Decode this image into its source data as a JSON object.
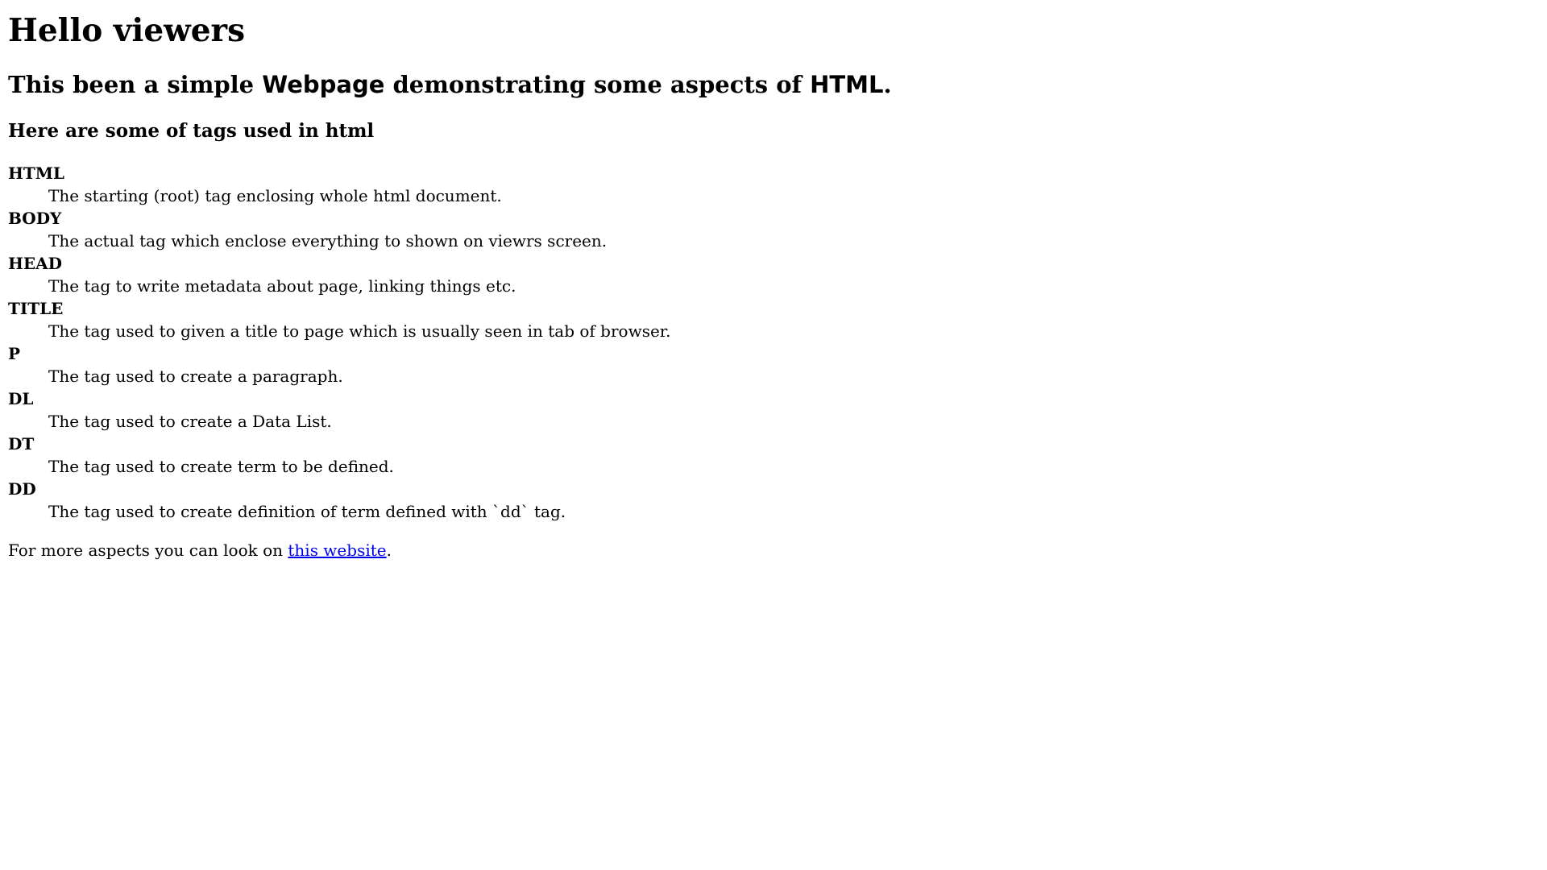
{
  "heading": "Hello viewers",
  "subheading": {
    "part1": "This been a simple ",
    "webpage": "Webpage",
    "part2": " demonstrating some aspects of ",
    "html": "HTML",
    "part3": "."
  },
  "tags_heading": "Here are some of tags used in html",
  "tags": [
    {
      "term": "HTML",
      "definition": "The starting (root) tag enclosing whole html document."
    },
    {
      "term": "BODY",
      "definition": "The actual tag which enclose everything to shown on viewrs screen."
    },
    {
      "term": "HEAD",
      "definition": "The tag to write metadata about page, linking things etc."
    },
    {
      "term": "TITLE",
      "definition": "The tag used to given a title to page which is usually seen in tab of browser."
    },
    {
      "term": "P",
      "definition": "The tag used to create a paragraph."
    },
    {
      "term": "DL",
      "definition": "The tag used to create a Data List."
    },
    {
      "term": "DT",
      "definition": "The tag used to create term to be defined."
    },
    {
      "term": "DD",
      "definition": "The tag used to create definition of term defined with `dd` tag."
    }
  ],
  "footer": {
    "prefix": "For more aspects you can look on ",
    "link_text": "this website",
    "suffix": "."
  },
  "colors": {
    "link": "#0000ee",
    "text": "#000000",
    "background": "#ffffff"
  }
}
